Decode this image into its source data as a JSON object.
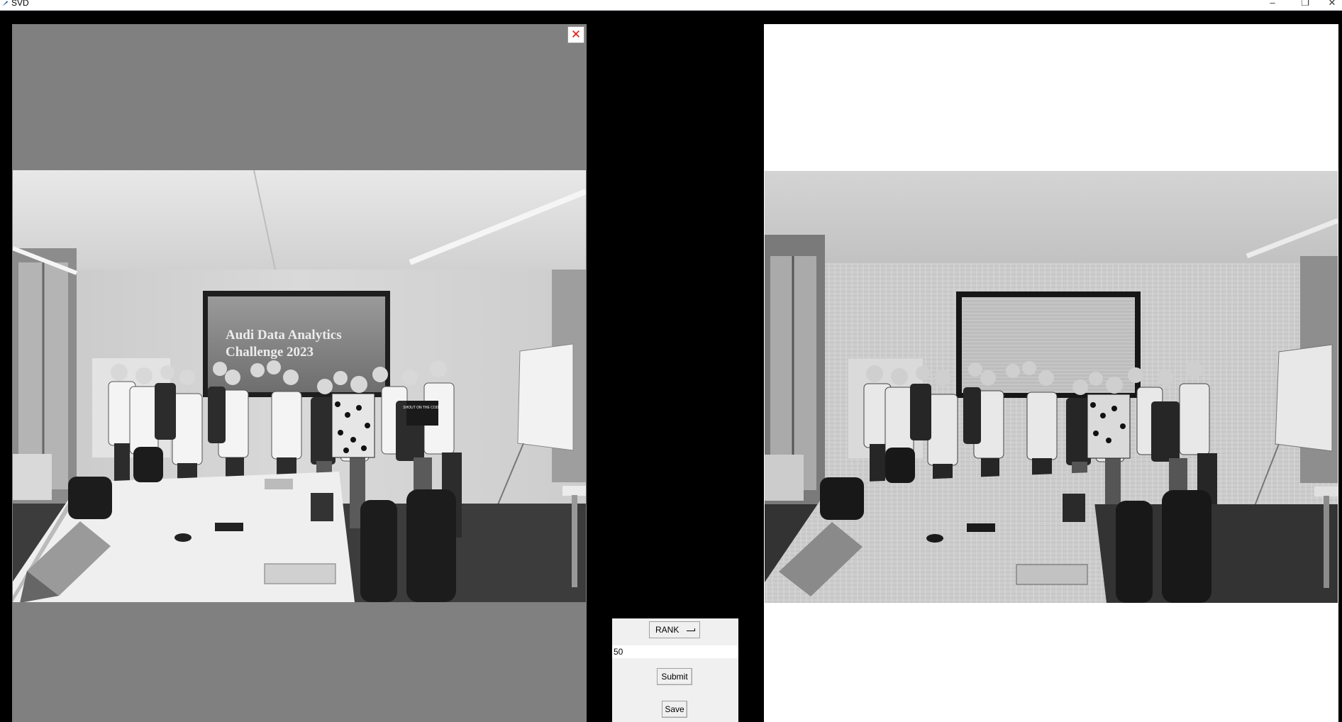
{
  "window": {
    "title": "SVD",
    "minimize_glyph": "–",
    "maximize_glyph": "❐",
    "close_glyph": "✕"
  },
  "left_view": {
    "close_glyph": "✕",
    "close_color": "#e01818",
    "background": "#808080",
    "slide_text_line1": "Audi Data Analytics",
    "slide_text_line2": "Challenge 2023",
    "shirt_text": "SHOUT ON THE CODE"
  },
  "right_view": {
    "background": "#ffffff"
  },
  "controls": {
    "rank_label": "RANK",
    "rank_value": "50",
    "submit_label": "Submit",
    "save_label": "Save"
  }
}
